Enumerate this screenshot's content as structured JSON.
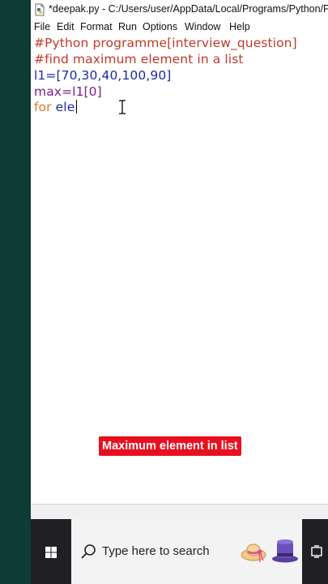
{
  "window": {
    "title": "*deepak.py - C:/Users/user/AppData/Local/Programs/Python/Python"
  },
  "menu": {
    "items": [
      "File",
      "Edit",
      "Format",
      "Run",
      "Options",
      "Window",
      "Help"
    ]
  },
  "editor": {
    "lines": [
      "#Python programme[interview_question]",
      "#find maximum element in a list",
      "l1=[70,30,40,100,90]",
      "max=l1[0]",
      "for",
      " ele"
    ]
  },
  "caption": "Maximum element in list",
  "taskbar": {
    "search_placeholder": "Type here to search"
  },
  "icons": {
    "app": "python-file-icon",
    "start": "windows-start-icon",
    "search": "magnifier-icon",
    "hat": "sun-hat-icon",
    "tophat": "top-hat-icon",
    "taskview": "task-view-icon"
  },
  "colors": {
    "comment": "#c0392b",
    "default": "#1c2aa8",
    "assign": "#7a1f8a",
    "keyword": "#e0782a",
    "caption_bg": "#e8101f",
    "taskbar_bg": "#1f1f24"
  }
}
